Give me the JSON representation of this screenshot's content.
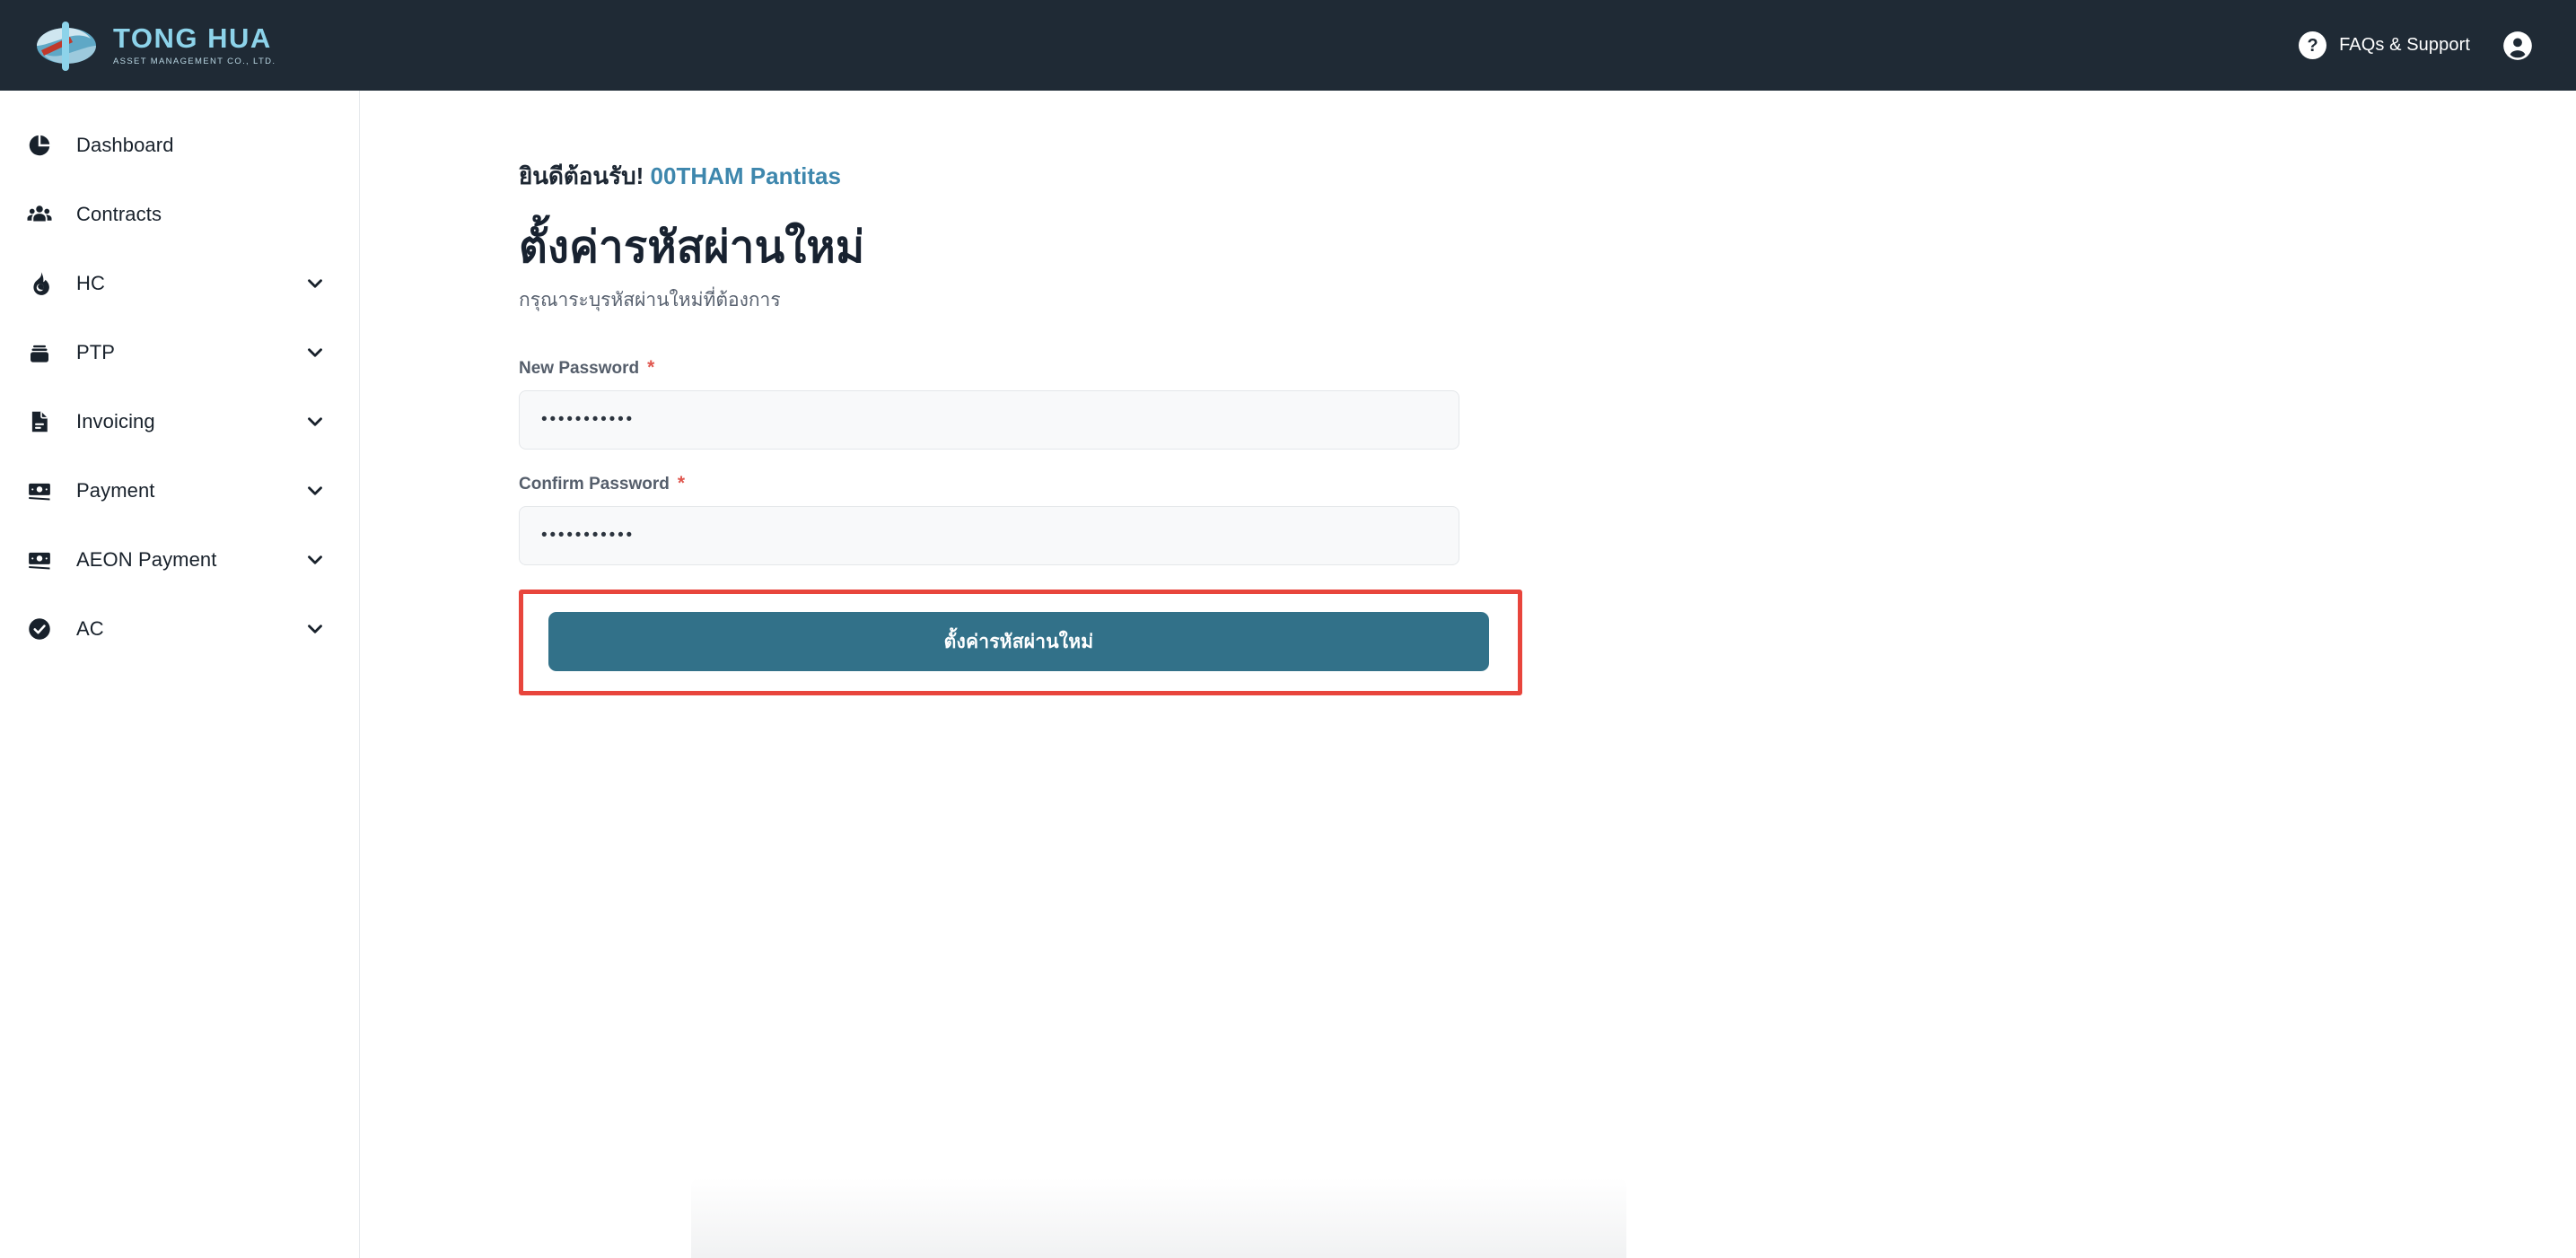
{
  "header": {
    "brand_name": "TONG HUA",
    "brand_sub": "ASSET MANAGEMENT CO., LTD.",
    "help_icon": "question-mark-circle-icon",
    "faq_label": "FAQs & Support",
    "account_icon": "account-circle-icon"
  },
  "sidebar": {
    "items": [
      {
        "label": "Dashboard",
        "icon": "pie-chart-icon",
        "expandable": false
      },
      {
        "label": "Contracts",
        "icon": "people-group-icon",
        "expandable": false
      },
      {
        "label": "HC",
        "icon": "fire-icon",
        "expandable": true
      },
      {
        "label": "PTP",
        "icon": "stack-box-icon",
        "expandable": true
      },
      {
        "label": "Invoicing",
        "icon": "document-icon",
        "expandable": true
      },
      {
        "label": "Payment",
        "icon": "banknote-icon",
        "expandable": true
      },
      {
        "label": "AEON Payment",
        "icon": "banknote-icon",
        "expandable": true
      },
      {
        "label": "AC",
        "icon": "check-circle-icon",
        "expandable": true
      }
    ],
    "chevron_icon": "chevron-down-icon"
  },
  "main": {
    "welcome_prefix": "ยินดีต้อนรับ!",
    "welcome_user": "00THAM Pantitas",
    "page_title": "ตั้งค่ารหัสผ่านใหม่",
    "page_subtitle": "กรุณาระบุรหัสผ่านใหม่ที่ต้องการ",
    "fields": [
      {
        "label": "New Password",
        "required_marker": "*",
        "value": "•••••••••••",
        "placeholder": ""
      },
      {
        "label": "Confirm Password",
        "required_marker": "*",
        "value": "•••••••••••",
        "placeholder": ""
      }
    ],
    "submit_label": "ตั้งค่ารหัสผ่านใหม่"
  },
  "colors": {
    "header_bg": "#1f2a35",
    "brand_accent": "#8dd3ea",
    "username_accent": "#3e87ad",
    "primary_button": "#327189",
    "highlight_box": "#e8453c",
    "required_marker": "#e0574f",
    "input_bg": "#f8f9fa"
  }
}
